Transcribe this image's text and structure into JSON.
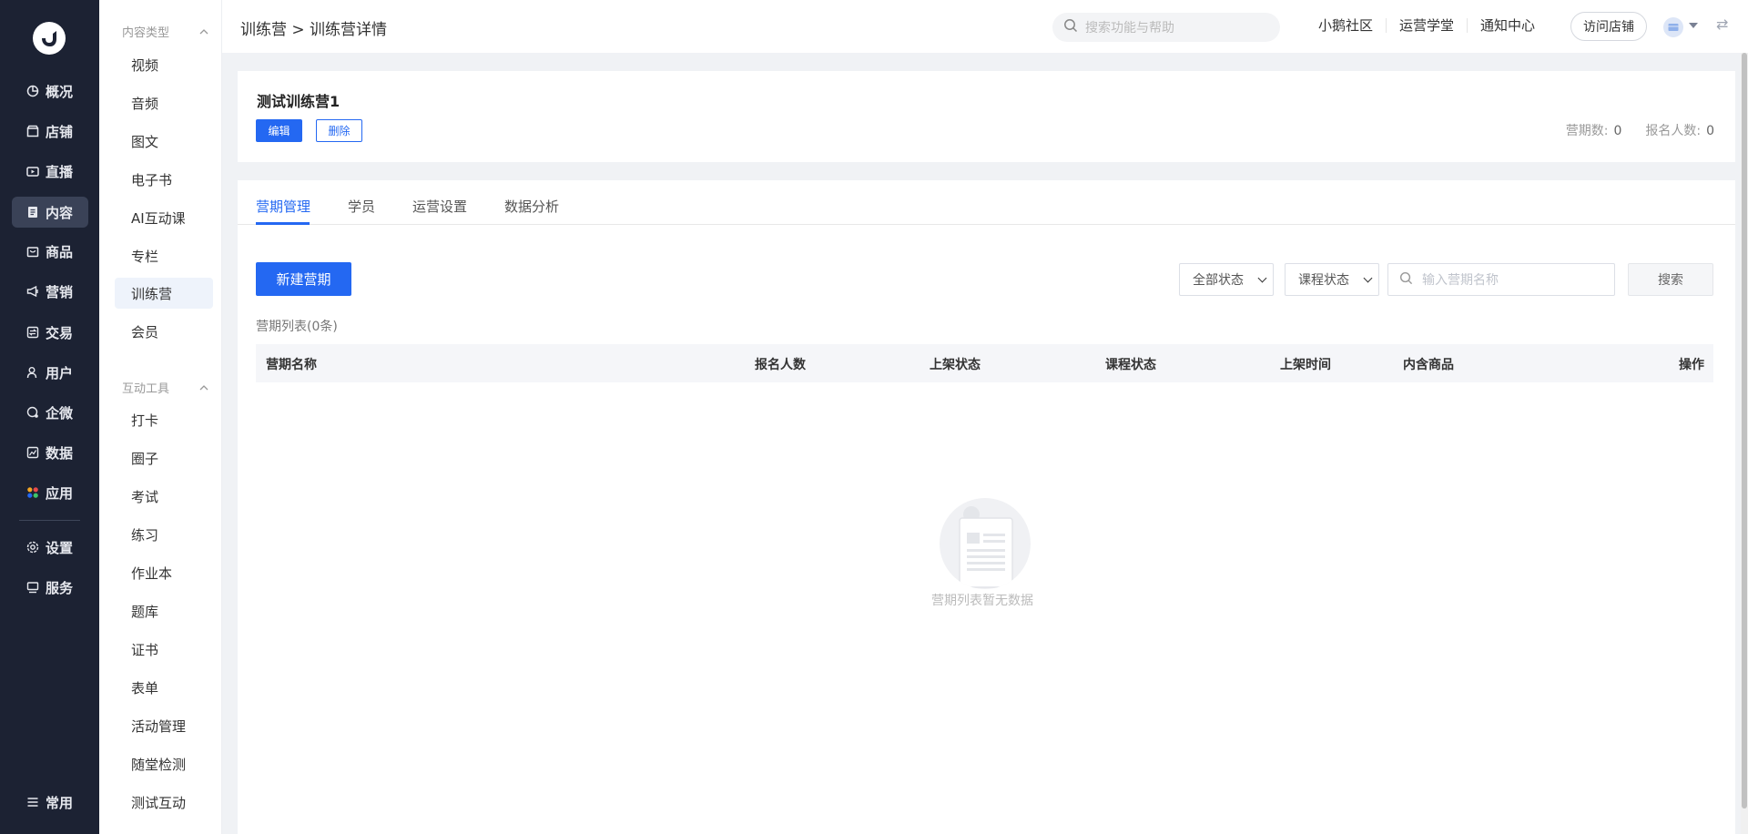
{
  "nav": {
    "items": [
      {
        "label": "概况",
        "icon": "pie-chart-icon"
      },
      {
        "label": "店铺",
        "icon": "store-icon"
      },
      {
        "label": "直播",
        "icon": "live-icon"
      },
      {
        "label": "内容",
        "icon": "document-icon",
        "active": true
      },
      {
        "label": "商品",
        "icon": "bag-icon"
      },
      {
        "label": "营销",
        "icon": "megaphone-icon"
      },
      {
        "label": "交易",
        "icon": "trade-icon"
      },
      {
        "label": "用户",
        "icon": "user-icon"
      },
      {
        "label": "企微",
        "icon": "wecom-icon"
      },
      {
        "label": "数据",
        "icon": "data-icon"
      },
      {
        "label": "应用",
        "icon": "apps-icon"
      }
    ],
    "bottom_items": [
      {
        "label": "设置",
        "icon": "gear-icon"
      },
      {
        "label": "服务",
        "icon": "service-icon"
      }
    ],
    "common_label": "常用"
  },
  "sidebar": {
    "group1_title": "内容类型",
    "group1_items": [
      "视频",
      "音频",
      "图文",
      "电子书",
      "AI互动课",
      "专栏",
      "训练营",
      "会员"
    ],
    "active_item": "训练营",
    "group2_title": "互动工具",
    "group2_items": [
      "打卡",
      "圈子",
      "考试",
      "练习",
      "作业本",
      "题库",
      "证书",
      "表单",
      "活动管理",
      "随堂检测",
      "测试互动"
    ]
  },
  "header": {
    "breadcrumb": "训练营 > 训练营详情",
    "search_placeholder": "搜索功能与帮助",
    "links": [
      "小鹅社区",
      "运营学堂",
      "通知中心"
    ],
    "visit_store": "访问店铺"
  },
  "camp": {
    "title": "测试训练营1",
    "edit_label": "编辑",
    "delete_label": "删除",
    "periods_label": "营期数:",
    "periods_value": "0",
    "signups_label": "报名人数:",
    "signups_value": "0"
  },
  "tabs": [
    "营期管理",
    "学员",
    "运营设置",
    "数据分析"
  ],
  "toolbar": {
    "new_period": "新建营期",
    "status_select": "全部状态",
    "course_select": "课程状态",
    "search_placeholder": "输入营期名称",
    "search_button": "搜索"
  },
  "list": {
    "count_text": "营期列表(0条)",
    "columns": [
      "营期名称",
      "报名人数",
      "上架状态",
      "课程状态",
      "上架时间",
      "内含商品",
      "操作"
    ],
    "empty_text": "营期列表暂无数据"
  },
  "colors": {
    "nav_bg": "#1c2233",
    "primary": "#2468f2"
  }
}
